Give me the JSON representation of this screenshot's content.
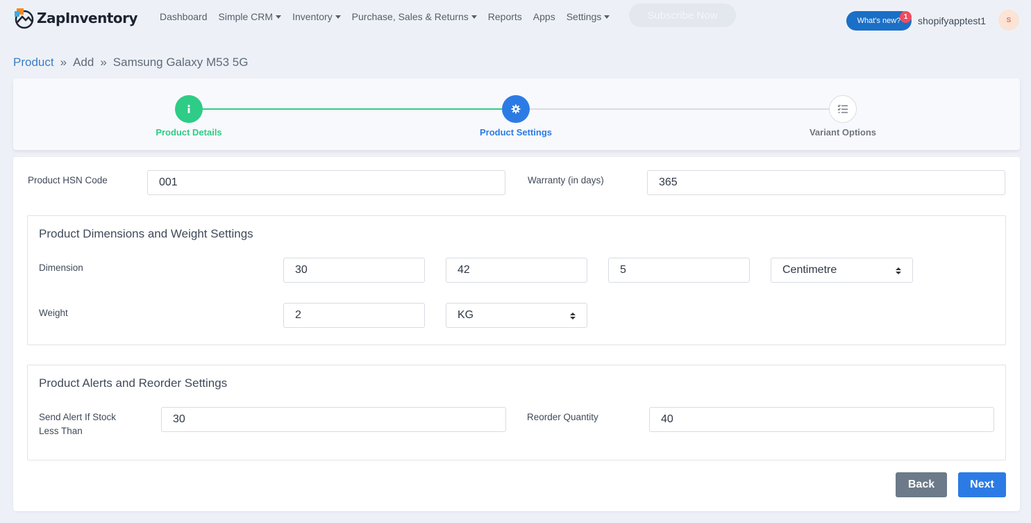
{
  "app": {
    "name": "ZapInventory"
  },
  "nav": {
    "items": [
      {
        "label": "Dashboard",
        "dropdown": false
      },
      {
        "label": "Simple CRM",
        "dropdown": true
      },
      {
        "label": "Inventory",
        "dropdown": true
      },
      {
        "label": "Purchase, Sales & Returns",
        "dropdown": true
      },
      {
        "label": "Reports",
        "dropdown": false
      },
      {
        "label": "Apps",
        "dropdown": false
      },
      {
        "label": "Settings",
        "dropdown": true
      }
    ],
    "subscribe_label": "Subscribe Now",
    "whats_new_label": "What's new?",
    "notification_count": "1",
    "username": "shopifyapptest1",
    "avatar_initial": "S"
  },
  "breadcrumb": {
    "items": [
      "Product",
      "Add",
      "Samsung Galaxy M53 5G"
    ],
    "separator": "»"
  },
  "stepper": {
    "steps": [
      {
        "label": "Product Details",
        "state": "completed",
        "icon": "info-icon"
      },
      {
        "label": "Product Settings",
        "state": "active",
        "icon": "gear-icon"
      },
      {
        "label": "Variant Options",
        "state": "pending",
        "icon": "checklist-icon"
      }
    ],
    "colors": {
      "completed": "#2ecc86",
      "active": "#2c7be5",
      "pending": "#6e7581"
    }
  },
  "form": {
    "hsn_label": "Product HSN Code",
    "hsn_value": "001",
    "warranty_label": "Warranty (in days)",
    "warranty_value": "365",
    "dimensions_section": {
      "title": "Product Dimensions and Weight Settings",
      "dimension_label": "Dimension",
      "length": "30",
      "width": "42",
      "height": "5",
      "dimension_unit": "Centimetre",
      "weight_label": "Weight",
      "weight_value": "2",
      "weight_unit": "KG"
    },
    "alerts_section": {
      "title": "Product Alerts and Reorder Settings",
      "alert_label": "Send Alert If Stock Less Than",
      "alert_value": "30",
      "reorder_label": "Reorder Quantity",
      "reorder_value": "40"
    }
  },
  "buttons": {
    "back_label": "Back",
    "next_label": "Next",
    "back_color": "#6c7a89",
    "next_color": "#2c7be5"
  }
}
